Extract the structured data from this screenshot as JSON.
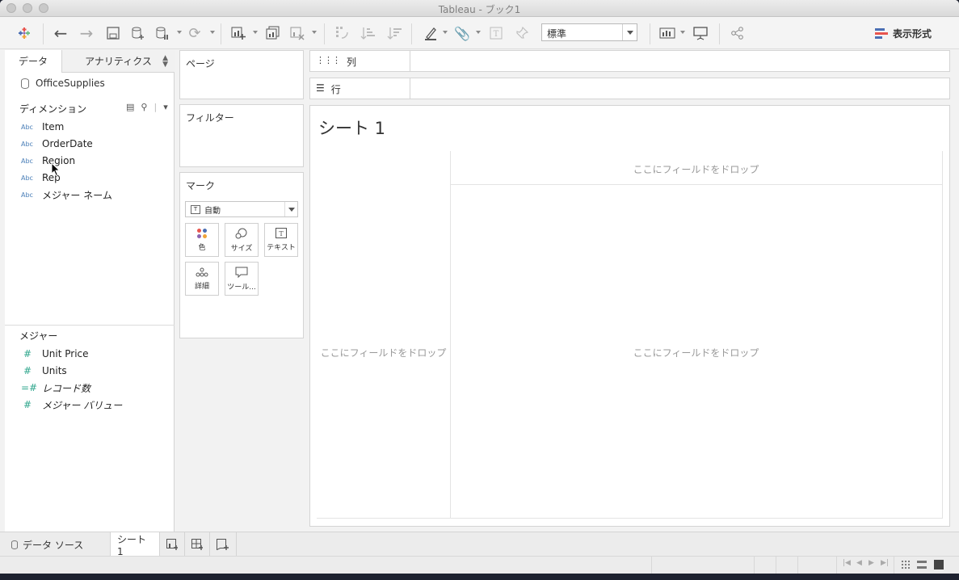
{
  "window": {
    "title": "Tableau - ブック1"
  },
  "toolbar": {
    "fit_value": "標準",
    "show_me_label": "表示形式",
    "icons": [
      "tableau-logo",
      "back",
      "forward",
      "save",
      "new-datasource",
      "pause-datasource",
      "refresh",
      "new-worksheet",
      "duplicate",
      "clear-sheet",
      "swap",
      "sort-ascending",
      "sort-descending",
      "highlight",
      "group",
      "label",
      "pin",
      "fit",
      "presentation",
      "share"
    ]
  },
  "data_pane": {
    "tab_data": "データ",
    "tab_analytics": "アナリティクス",
    "datasource": "OfficeSupplies",
    "dimensions_header": "ディメンション",
    "dimensions": [
      {
        "type": "Abc",
        "name": "Item"
      },
      {
        "type": "Abc",
        "name": "OrderDate"
      },
      {
        "type": "Abc",
        "name": "Region"
      },
      {
        "type": "Abc",
        "name": "Rep"
      },
      {
        "type": "Abc",
        "name": "メジャー ネーム"
      }
    ],
    "measures_header": "メジャー",
    "measures": [
      {
        "name": "Unit Price"
      },
      {
        "name": "Units"
      },
      {
        "name": "レコード数"
      },
      {
        "name": "メジャー バリュー"
      }
    ]
  },
  "cards": {
    "pages": "ページ",
    "filters": "フィルター",
    "marks": "マーク",
    "mark_type": "自動",
    "mark_buttons": {
      "color": "色",
      "size": "サイズ",
      "text": "テキスト",
      "detail": "詳細",
      "tooltip": "ツール..."
    }
  },
  "shelves": {
    "columns": "列",
    "rows": "行"
  },
  "viz": {
    "sheet_title": "シート 1",
    "drop_top": "ここにフィールドをドロップ",
    "drop_left": "ここにフィールドをドロップ",
    "drop_center": "ここにフィールドをドロップ"
  },
  "sheet_tabs": {
    "datasource_tab": "データ ソース",
    "sheet1_tab": "シート 1"
  },
  "colors": {
    "accent_blue": "#4a7fb8",
    "measure_green": "#2ea68c",
    "showme_blue": "#4b6fb4",
    "showme_red": "#e8554e"
  }
}
